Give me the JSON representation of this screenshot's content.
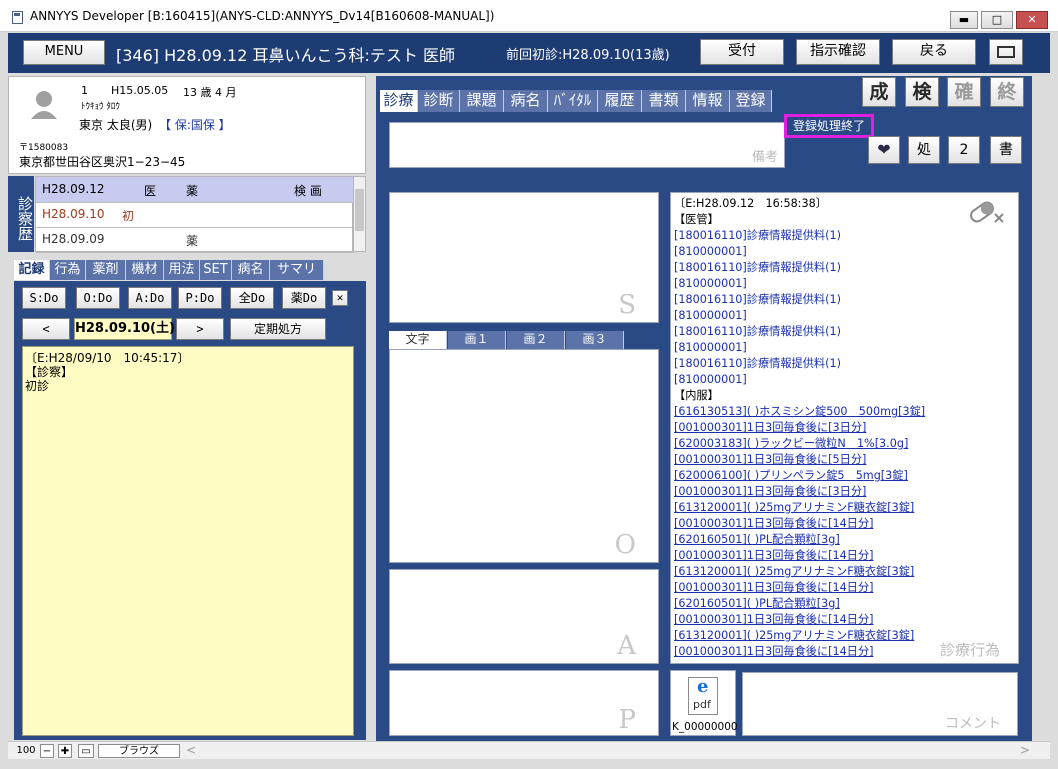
{
  "window": {
    "title": "ANNYYS Developer [B:160415](ANYS-CLD:ANNYYS_Dv14[B160608-MANUAL])",
    "min_label": "▬",
    "max_label": "□",
    "close_label": "✕"
  },
  "header": {
    "menu_label": "MENU",
    "patient_summary": "[346] H28.09.12 耳鼻いんこう科:テスト 医師",
    "first_visit": "前回初診:H28.09.10(13歳)",
    "reception_label": "受付",
    "instruction_label": "指示確認",
    "back_label": "戻る"
  },
  "patient": {
    "number": "1",
    "birth": "H15.05.05",
    "age": "13 歳 4 月",
    "kana": "ﾄｳｷｮｳ ﾀﾛｳ",
    "name": "東京 太良(男)",
    "insurance": "【 保:国保 】",
    "postal": "〒1580083",
    "address": "東京都世田谷区奥沢1−23−45"
  },
  "history": {
    "label": "診察歴",
    "header": {
      "date": "H28.09.12",
      "c1": "医",
      "c2": "薬",
      "c3": "検 画"
    },
    "rows": [
      {
        "date": "H28.09.10",
        "mark": "初",
        "mark2": ""
      },
      {
        "date": "H28.09.09",
        "mark": "",
        "mark2": "薬"
      }
    ]
  },
  "left_tabs": [
    "記録",
    "行為",
    "薬剤",
    "機材",
    "用法",
    "SET",
    "病名",
    "サマリ"
  ],
  "soap_buttons": [
    "S:Do",
    "O:Do",
    "A:Do",
    "P:Do",
    "全Do",
    "薬Do"
  ],
  "close_small": "✕",
  "date_nav": {
    "prev": "<",
    "date": "H28.09.10(土)",
    "next": ">",
    "fixed": "定期処方"
  },
  "notes": [
    "〔E:H28/09/10　10:45:17〕",
    "【診察】",
    "初診"
  ],
  "right_tabs": [
    "診療",
    "診断",
    "課題",
    "病名",
    "ﾊﾞｲﾀﾙ",
    "履歴",
    "書類",
    "情報",
    "登録"
  ],
  "action_buttons": {
    "sei": "成",
    "ken": "検",
    "kaku": "確",
    "owari": "終"
  },
  "badge": "登録処理終了",
  "memo_placeholder": "備考",
  "small_buttons": {
    "heart": "❤",
    "sho": "処",
    "two": "2",
    "doc": "書"
  },
  "soap_watermarks": {
    "s": "S",
    "o": "O",
    "a": "A",
    "p": "P"
  },
  "image_tabs": [
    "文字",
    "画１",
    "画２",
    "画３"
  ],
  "orders": {
    "lines": [
      {
        "t": "〔E:H28.09.12　16:58:38〕",
        "c": "ts"
      },
      {
        "t": "【医管】",
        "c": "sec"
      },
      {
        "t": "[180016110]診療情報提供料(1)",
        "c": "code"
      },
      {
        "t": "[810000001]",
        "c": "code"
      },
      {
        "t": "[180016110]診療情報提供料(1)",
        "c": "code"
      },
      {
        "t": "[810000001]",
        "c": "code"
      },
      {
        "t": "[180016110]診療情報提供料(1)",
        "c": "code"
      },
      {
        "t": "[810000001]",
        "c": "code"
      },
      {
        "t": "[180016110]診療情報提供料(1)",
        "c": "code"
      },
      {
        "t": "[810000001]",
        "c": "code"
      },
      {
        "t": "[180016110]診療情報提供料(1)",
        "c": "code"
      },
      {
        "t": "[810000001]",
        "c": "code"
      },
      {
        "t": "【内服】",
        "c": "sec"
      },
      {
        "t": "[616130513]( )ホスミシン錠500　500mg[3錠]",
        "c": "code und"
      },
      {
        "t": "[001000301]1日3回毎食後に[3日分]",
        "c": "code und"
      },
      {
        "t": "[620003183]( )ラックビー微粒N　1%[3.0g]",
        "c": "code und"
      },
      {
        "t": "[001000301]1日3回毎食後に[5日分]",
        "c": "code und"
      },
      {
        "t": "[620006100]( )プリンペラン錠5　5mg[3錠]",
        "c": "code und"
      },
      {
        "t": "[001000301]1日3回毎食後に[3日分]",
        "c": "code und"
      },
      {
        "t": "[613120001]( )25mgアリナミンF糖衣錠[3錠]",
        "c": "code und"
      },
      {
        "t": "[001000301]1日3回毎食後に[14日分]",
        "c": "code und"
      },
      {
        "t": "[620160501]( )PL配合顆粒[3g]",
        "c": "code und"
      },
      {
        "t": "[001000301]1日3回毎食後に[14日分]",
        "c": "code und"
      },
      {
        "t": "[613120001]( )25mgアリナミンF糖衣錠[3錠]",
        "c": "code und"
      },
      {
        "t": "[001000301]1日3回毎食後に[14日分]",
        "c": "code und"
      },
      {
        "t": "[620160501]( )PL配合顆粒[3g]",
        "c": "code und"
      },
      {
        "t": "[001000301]1日3回毎食後に[14日分]",
        "c": "code und"
      },
      {
        "t": "[613120001]( )25mgアリナミンF糖衣錠[3錠]",
        "c": "code und"
      },
      {
        "t": "[001000301]1日3回毎食後に[14日分]",
        "c": "code und"
      }
    ],
    "watermark": "診療行為"
  },
  "attachment": {
    "icon_label": "pdf",
    "filename": "K_00000000"
  },
  "comment_placeholder": "コメント",
  "status": {
    "zoom": "100",
    "minus": "−",
    "plus": "✚",
    "browse": "ブラウズ",
    "arrow_left": "<",
    "arrow_right": ">"
  },
  "colors": {
    "navy": "#1e3c74",
    "panel": "#2a4a86",
    "notes_bg": "#fffdc4",
    "badge_border": "#e020e0",
    "code_text": "#1a2fb0"
  }
}
